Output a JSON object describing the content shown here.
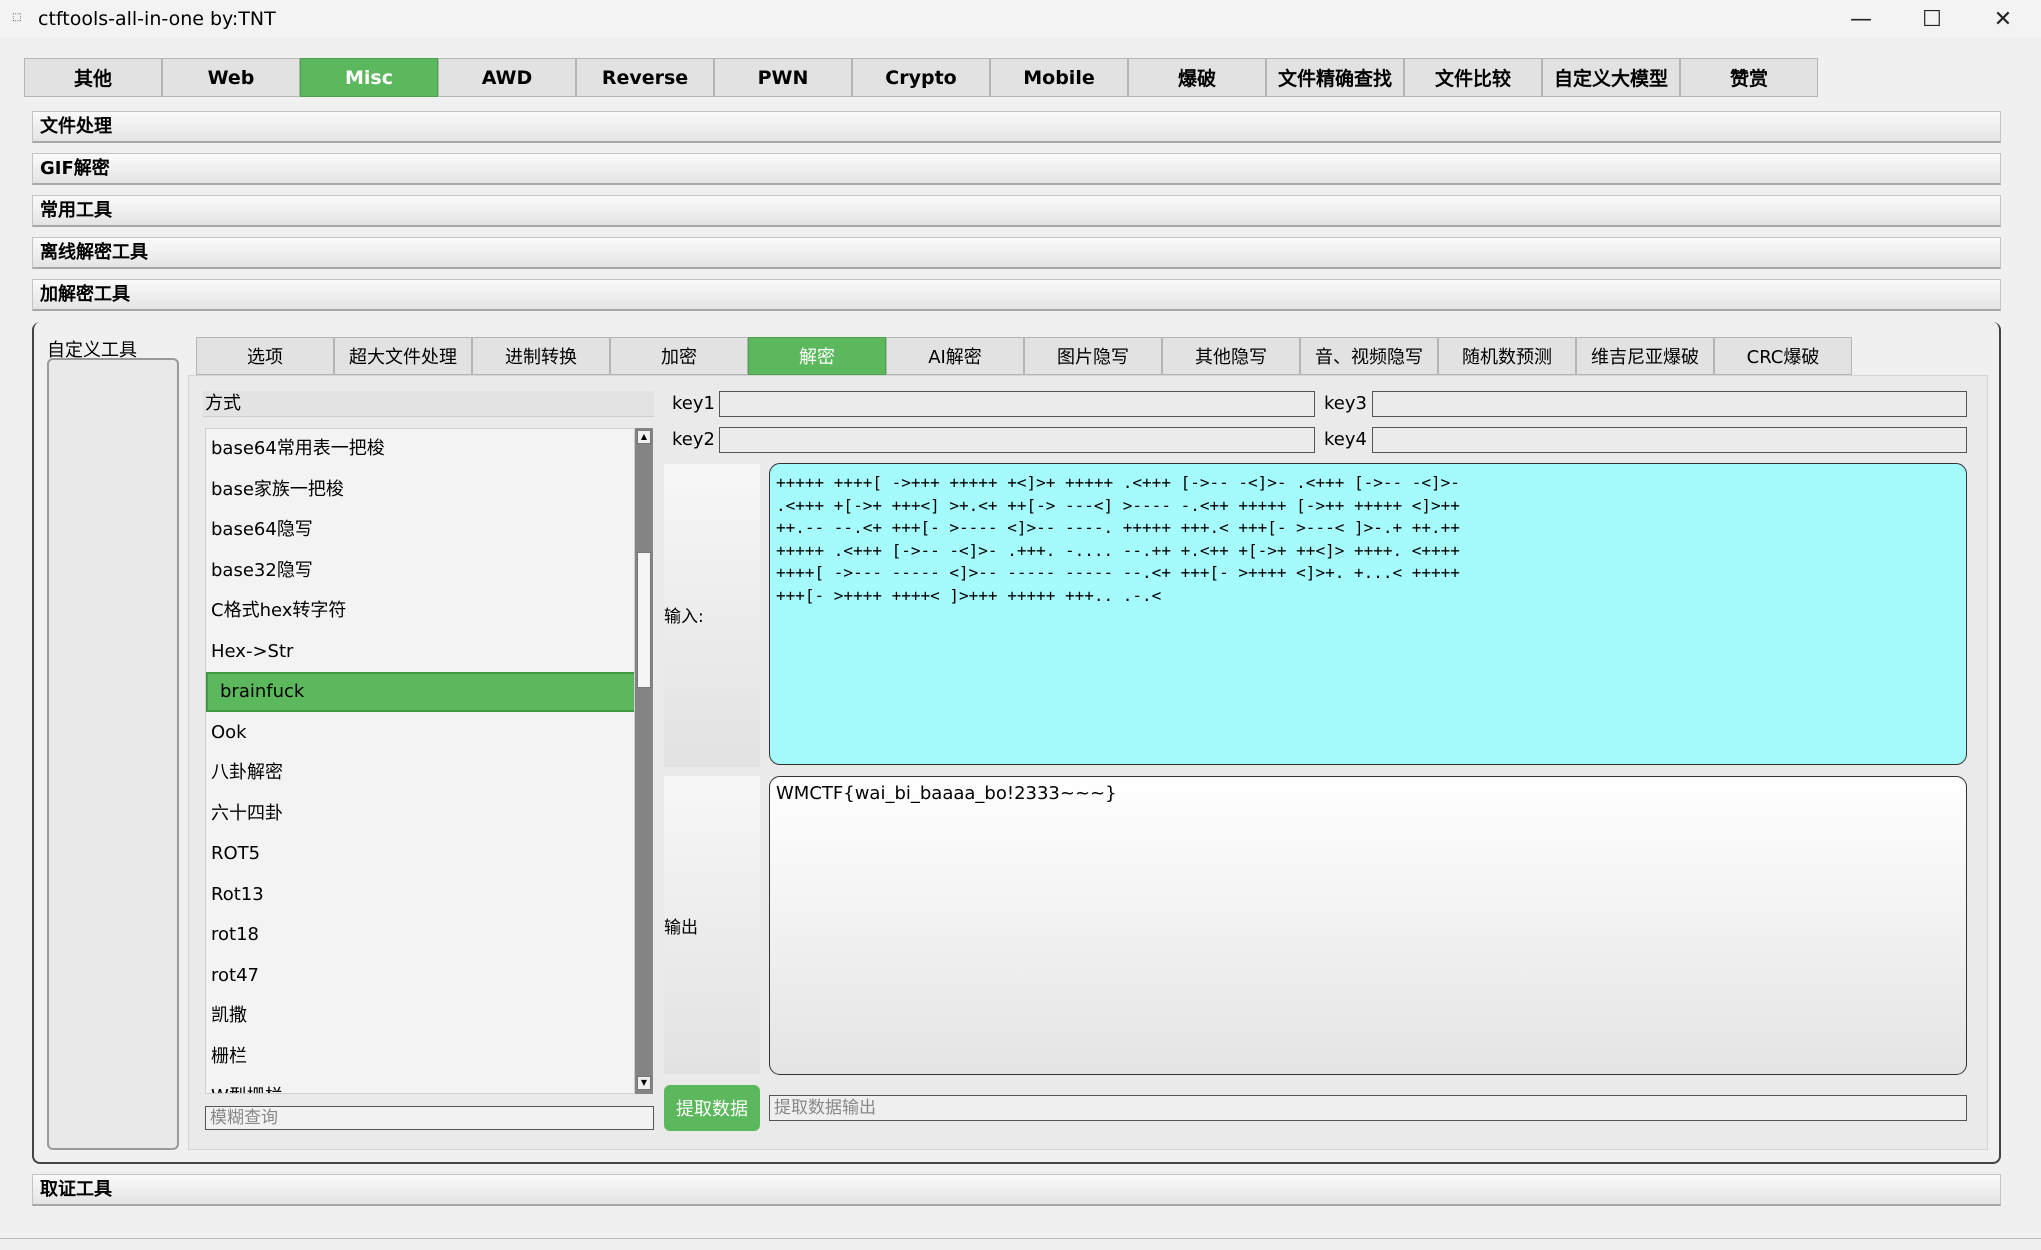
{
  "window": {
    "title": "ctftools-all-in-one   by:TNT",
    "app_icon": "app-icon",
    "minimize_glyph": "—",
    "maximize_glyph": "☐",
    "close_glyph": "✕"
  },
  "top_tabs": [
    {
      "label": "其他",
      "active": false
    },
    {
      "label": "Web",
      "active": false
    },
    {
      "label": "Misc",
      "active": true
    },
    {
      "label": "AWD",
      "active": false
    },
    {
      "label": "Reverse",
      "active": false
    },
    {
      "label": "PWN",
      "active": false
    },
    {
      "label": "Crypto",
      "active": false
    },
    {
      "label": "Mobile",
      "active": false
    },
    {
      "label": "爆破",
      "active": false
    },
    {
      "label": "文件精确查找",
      "active": false
    },
    {
      "label": "文件比较",
      "active": false
    },
    {
      "label": "自定义大模型",
      "active": false
    },
    {
      "label": "赞赏",
      "active": false
    }
  ],
  "sections": {
    "file_processing": "文件处理",
    "gif_decrypt": "GIF解密",
    "common_tools": "常用工具",
    "offline_decrypt": "离线解密工具",
    "encrypt_decrypt": "加解密工具",
    "forensics": "取证工具"
  },
  "custom_tools_label": "自定义工具",
  "sub_tabs": [
    {
      "label": "选项",
      "active": false
    },
    {
      "label": "超大文件处理",
      "active": false
    },
    {
      "label": "进制转换",
      "active": false
    },
    {
      "label": "加密",
      "active": false
    },
    {
      "label": "解密",
      "active": true
    },
    {
      "label": "AI解密",
      "active": false
    },
    {
      "label": "图片隐写",
      "active": false
    },
    {
      "label": "其他隐写",
      "active": false
    },
    {
      "label": "音、视频隐写",
      "active": false
    },
    {
      "label": "随机数预测",
      "active": false
    },
    {
      "label": "维吉尼亚爆破",
      "active": false
    },
    {
      "label": "CRC爆破",
      "active": false
    }
  ],
  "method": {
    "header": "方式",
    "items": [
      "base64常用表一把梭",
      "base家族一把梭",
      "base64隐写",
      "base32隐写",
      "C格式hex转字符",
      "Hex->Str",
      "brainfuck",
      "Ook",
      "八卦解密",
      "六十四卦",
      "ROT5",
      "Rot13",
      "rot18",
      "rot47",
      "凯撒",
      "栅栏",
      "W型栅栏"
    ],
    "selected": "brainfuck",
    "search_placeholder": "模糊查询",
    "scroll_up_glyph": "▲",
    "scroll_down_glyph": "▼"
  },
  "keys": {
    "key1": {
      "label": "key1",
      "value": ""
    },
    "key2": {
      "label": "key2",
      "value": ""
    },
    "key3": {
      "label": "key3",
      "value": ""
    },
    "key4": {
      "label": "key4",
      "value": ""
    }
  },
  "input": {
    "label": "输入:",
    "value": "+++++ ++++[ ->+++ +++++ +<]>+ +++++ .<+++ [->-- -<]>- .<+++ [->-- -<]>-\n.<+++ +[->+ +++<] >+.<+ ++[-> ---<] >---- -.<++ +++++ [->++ +++++ <]>++\n++.-- --.<+ +++[- >---- <]>-- ----. +++++ +++.< +++[- >---< ]>-.+ ++.++\n+++++ .<+++ [->-- -<]>- .+++. -.... --.++ +.<++ +[->+ ++<]> ++++. <++++\n++++[ ->--- ----- <]>-- ----- ----- --.<+ +++[- >++++ <]>+. +...< +++++\n+++[- >++++ ++++< ]>+++ +++++ +++.. .-.<"
  },
  "output": {
    "label": "输出",
    "value": "WMCTF{wai_bi_baaaa_bo!2333~~~}"
  },
  "extract": {
    "button_label": "提取数据",
    "output_placeholder": "提取数据输出"
  },
  "colors": {
    "accent_green": "#5cb85c",
    "input_bg": "#a5fbfb"
  }
}
